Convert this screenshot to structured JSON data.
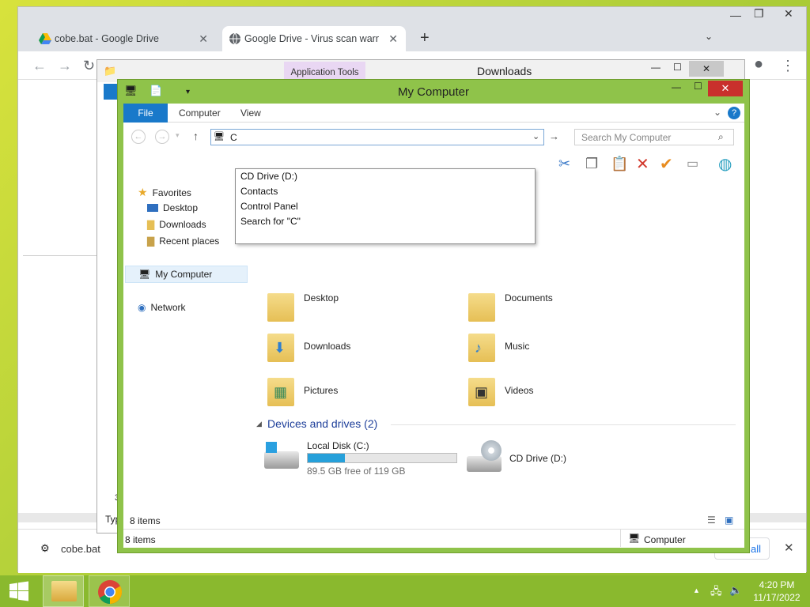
{
  "browser": {
    "tabs": [
      {
        "title": "cobe.bat - Google Drive"
      },
      {
        "title": "Google Drive - Virus scan warnin"
      }
    ],
    "download_item": "cobe.bat",
    "show_all_label": "all"
  },
  "downloads_window": {
    "title": "Downloads",
    "app_tools_label": "Application Tools",
    "partial_text_1": "3",
    "partial_text_2": "Typ"
  },
  "explorer": {
    "title": "My Computer",
    "ribbon_tabs": [
      "File",
      "Computer",
      "View"
    ],
    "address_value": "C",
    "search_placeholder": "Search My Computer",
    "autocomplete": [
      "CD Drive (D:)",
      "Contacts",
      "Control Panel",
      "Search for \"C\""
    ],
    "nav": {
      "favorites": "Favorites",
      "desktop": "Desktop",
      "downloads": "Downloads",
      "recent": "Recent places",
      "my_computer": "My Computer",
      "network": "Network"
    },
    "folders": [
      "Desktop",
      "Documents",
      "Downloads",
      "Music",
      "Pictures",
      "Videos"
    ],
    "devices_header": "Devices and drives (2)",
    "local_disk": {
      "name": "Local Disk (C:)",
      "free_text": "89.5 GB free of 119 GB",
      "used_fraction": 0.25
    },
    "cd_drive": "CD Drive (D:)",
    "items_count_inner": "8 items",
    "items_count_outer": "8 items",
    "status_location": "Computer"
  },
  "taskbar": {
    "time": "4:20 PM",
    "date": "11/17/2022"
  }
}
